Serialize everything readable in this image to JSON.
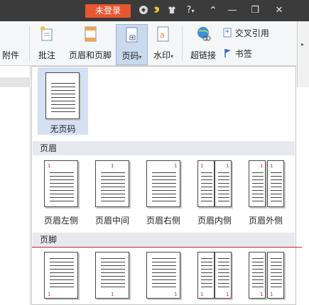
{
  "titlebar": {
    "login_label": "未登录",
    "icons": [
      "shield-icon",
      "skin-icon",
      "shirt-icon",
      "help-icon",
      "collapse-icon",
      "minimize-icon",
      "restore-icon",
      "close-icon"
    ],
    "help_label": "?",
    "chevron": "▾",
    "collapse_glyph": "⌃",
    "minimize_glyph": "—",
    "restore_glyph": "❐",
    "close_glyph": "✕"
  },
  "ribbon": {
    "attachment_label": "附件",
    "comment_label": "批注",
    "header_footer_label": "页眉和页脚",
    "page_number_label": "页码",
    "watermark_label": "水印",
    "hyperlink_label": "超链接",
    "cross_reference_label": "交叉引用",
    "bookmark_label": "书签",
    "dropdown_arrow": "▾"
  },
  "dropdown": {
    "no_page_number_label": "无页码",
    "header_section_label": "页眉",
    "footer_section_label": "页脚",
    "header_options": [
      {
        "label": "页眉左侧"
      },
      {
        "label": "页眉中间"
      },
      {
        "label": "页眉右侧"
      },
      {
        "label": "页眉内侧"
      },
      {
        "label": "页眉外侧"
      }
    ],
    "page_digit": "1"
  },
  "colors": {
    "titlebar_bg": "#3b3b3b",
    "login_button": "#e8552f",
    "selected_tile": "#d3e1f2",
    "section_header_bg": "#e7e9ee",
    "page_number_red": "#c0392b",
    "annotation_red_line": "#c3262b"
  }
}
